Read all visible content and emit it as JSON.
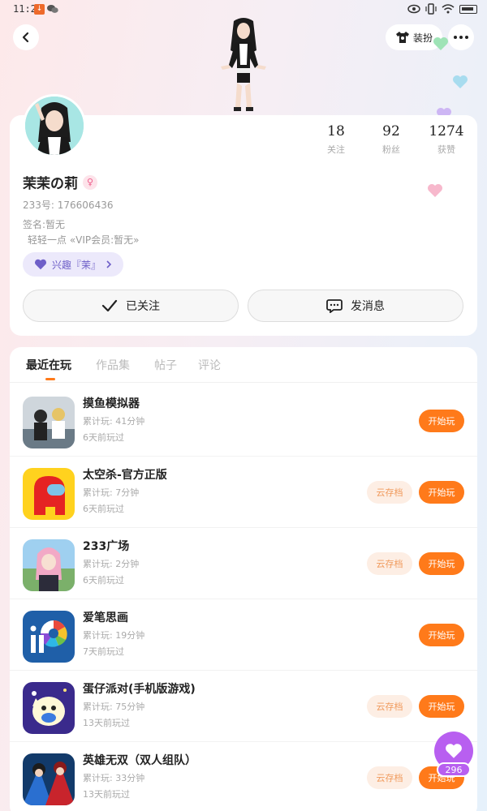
{
  "status_bar": {
    "time": "11:22",
    "download_badge": "↓"
  },
  "header": {
    "dress_label": "装扮"
  },
  "profile": {
    "username": "茉茉の莉",
    "gender_symbol": "♀",
    "uid_line": "233号: 176606436",
    "bio_line1": "签名:暂无",
    "bio_line2": "轻轻一点 «VIP会员:暂无»",
    "tag_label": "兴趣『茉』",
    "stats": [
      {
        "num": "18",
        "label": "关注"
      },
      {
        "num": "92",
        "label": "粉丝"
      },
      {
        "num": "1274",
        "label": "获赞"
      }
    ],
    "follow_label": "已关注",
    "message_label": "发消息"
  },
  "tabs": [
    "最近在玩",
    "作品集",
    "帖子",
    "评论"
  ],
  "games": [
    {
      "title": "摸鱼模拟器",
      "meta1": "累计玩: 41分钟",
      "meta2": "6天前玩过",
      "cloud": "",
      "play": "开始玩"
    },
    {
      "title": "太空杀-官方正版",
      "meta1": "累计玩: 7分钟",
      "meta2": "6天前玩过",
      "cloud": "云存档",
      "play": "开始玩"
    },
    {
      "title": "233广场",
      "meta1": "累计玩: 2分钟",
      "meta2": "6天前玩过",
      "cloud": "云存档",
      "play": "开始玩"
    },
    {
      "title": "爱笔思画",
      "meta1": "累计玩: 19分钟",
      "meta2": "7天前玩过",
      "cloud": "",
      "play": "开始玩"
    },
    {
      "title": "蛋仔派对(手机版游戏)",
      "meta1": "累计玩: 75分钟",
      "meta2": "13天前玩过",
      "cloud": "云存档",
      "play": "开始玩"
    },
    {
      "title": "英雄无双（双人组队）",
      "meta1": "累计玩: 33分钟",
      "meta2": "13天前玩过",
      "cloud": "云存档",
      "play": "开始玩"
    }
  ],
  "likes": {
    "count": "296"
  },
  "colors": {
    "accent": "#ff7a1a",
    "like": "#b85ff0",
    "tag": "#6e5fc8"
  }
}
